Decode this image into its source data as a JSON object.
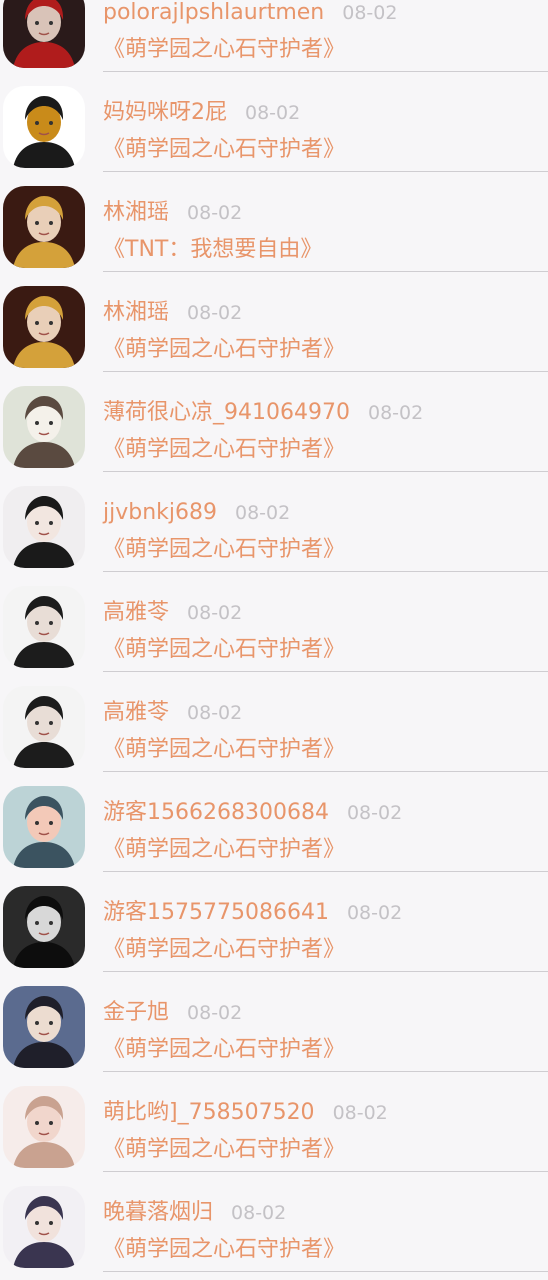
{
  "comments": [
    {
      "name": "polorajlpshlaurtmen",
      "date": "08-02",
      "title": "《萌学园之心石守护者》",
      "avatar_icon": "masked-face-avatar",
      "bg": "#2a1a1a",
      "fg": "#d9c3b8",
      "accent": "#b01c1c"
    },
    {
      "name": "妈妈咪呀2屁",
      "date": "08-02",
      "title": "《萌学园之心石守护者》",
      "avatar_icon": "wolf-now-logo-avatar",
      "bg": "#ffffff",
      "fg": "#c98b1a",
      "accent": "#1a1a1a"
    },
    {
      "name": "林湘瑶",
      "date": "08-02",
      "title": "《TNT：我想要自由》",
      "avatar_icon": "costume-portrait-avatar",
      "bg": "#3a1a12",
      "fg": "#e9cfb8",
      "accent": "#d4a13a"
    },
    {
      "name": "林湘瑶",
      "date": "08-02",
      "title": "《萌学园之心石守护者》",
      "avatar_icon": "costume-portrait-avatar",
      "bg": "#3a1a12",
      "fg": "#e9cfb8",
      "accent": "#d4a13a"
    },
    {
      "name": "薄荷很心凉_941064970",
      "date": "08-02",
      "title": "《萌学园之心石守护者》",
      "avatar_icon": "girl-with-dog-avatar",
      "bg": "#dfe3d8",
      "fg": "#f4f1ea",
      "accent": "#5a4a40"
    },
    {
      "name": "jjvbnkj689",
      "date": "08-02",
      "title": "《萌学园之心石守护者》",
      "avatar_icon": "anime-striped-avatar",
      "bg": "#f0eef0",
      "fg": "#f2e6e0",
      "accent": "#1a1a1a"
    },
    {
      "name": "高雅苓",
      "date": "08-02",
      "title": "《萌学园之心石守护者》",
      "avatar_icon": "dark-hair-man-avatar",
      "bg": "#f4f4f4",
      "fg": "#e8ddd6",
      "accent": "#1c1c1c"
    },
    {
      "name": "高雅苓",
      "date": "08-02",
      "title": "《萌学园之心石守护者》",
      "avatar_icon": "dark-hair-man-avatar",
      "bg": "#f4f4f4",
      "fg": "#e8ddd6",
      "accent": "#1c1c1c"
    },
    {
      "name": "游客1566268300684",
      "date": "08-02",
      "title": "《萌学园之心石守护者》",
      "avatar_icon": "sunset-photo-avatar",
      "bg": "#bcd3d6",
      "fg": "#f3c9b8",
      "accent": "#3b5360"
    },
    {
      "name": "游客1575775086641",
      "date": "08-02",
      "title": "《萌学园之心石守护者》",
      "avatar_icon": "mirror-selfie-avatar",
      "bg": "#2a2a2a",
      "fg": "#d8d8d8",
      "accent": "#0d0d0d"
    },
    {
      "name": "金子旭",
      "date": "08-02",
      "title": "《萌学园之心石守护者》",
      "avatar_icon": "young-man-avatar",
      "bg": "#5b6b8f",
      "fg": "#ecdcd0",
      "accent": "#1f1f2a"
    },
    {
      "name": "萌比哟]_758507520",
      "date": "08-02",
      "title": "《萌学园之心石守护者》",
      "avatar_icon": "chibi-girl-avatar",
      "bg": "#f6ecea",
      "fg": "#f1d6cc",
      "accent": "#c9a290"
    },
    {
      "name": "晚暮落烟归",
      "date": "08-02",
      "title": "《萌学园之心石守护者》",
      "avatar_icon": "anime-duo-avatar",
      "bg": "#f2f0f4",
      "fg": "#f1e2dc",
      "accent": "#3a3550"
    }
  ]
}
